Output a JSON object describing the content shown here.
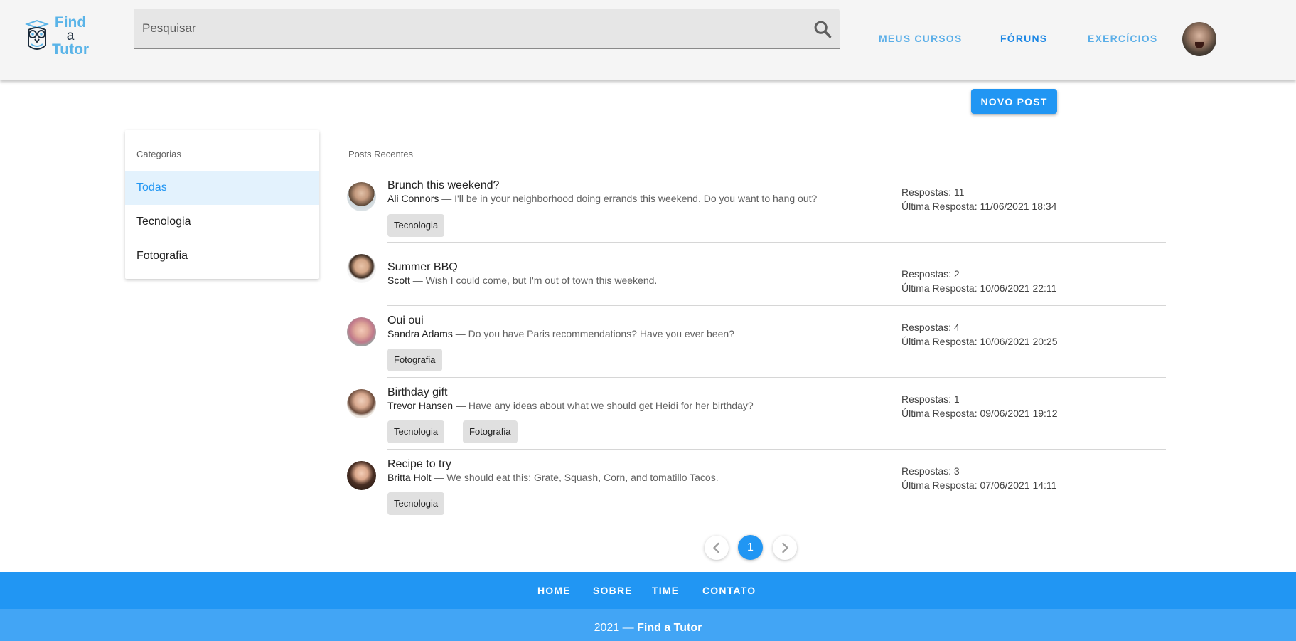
{
  "header": {
    "logo": {
      "line1": "Find",
      "line2": "a",
      "line3": "Tutor"
    },
    "search_placeholder": "Pesquisar",
    "nav": [
      "MEUS CURSOS",
      "FÓRUNS",
      "EXERCÍCIOS"
    ],
    "active_nav": "FÓRUNS"
  },
  "new_post_label": "NOVO POST",
  "categories": {
    "title": "Categorias",
    "items": [
      "Todas",
      "Tecnologia",
      "Fotografia"
    ],
    "selected": "Todas"
  },
  "posts": {
    "title": "Posts Recentes",
    "items": [
      {
        "title": "Brunch this weekend?",
        "author": "Ali Connors",
        "excerpt": " — I'll be in your neighborhood doing errands this weekend. Do you want to hang out?",
        "replies": "Respostas: 11",
        "last_reply": "Última Resposta: 11/06/2021 18:34",
        "tags": [
          "Tecnologia"
        ]
      },
      {
        "title": "Summer BBQ",
        "author": "Scott",
        "excerpt": " — Wish I could come, but I'm out of town this weekend.",
        "replies": "Respostas: 2",
        "last_reply": "Última Resposta: 10/06/2021 22:11",
        "tags": []
      },
      {
        "title": "Oui oui",
        "author": "Sandra Adams",
        "excerpt": " — Do you have Paris recommendations? Have you ever been?",
        "replies": "Respostas: 4",
        "last_reply": "Última Resposta: 10/06/2021 20:25",
        "tags": [
          "Fotografia"
        ]
      },
      {
        "title": "Birthday gift",
        "author": "Trevor Hansen",
        "excerpt": " — Have any ideas about what we should get Heidi for her birthday?",
        "replies": "Respostas: 1",
        "last_reply": "Última Resposta: 09/06/2021 19:12",
        "tags": [
          "Tecnologia",
          "Fotografia"
        ]
      },
      {
        "title": "Recipe to try",
        "author": "Britta Holt",
        "excerpt": " — We should eat this: Grate, Squash, Corn, and tomatillo Tacos.",
        "replies": "Respostas: 3",
        "last_reply": "Última Resposta: 07/06/2021 14:11",
        "tags": [
          "Tecnologia"
        ]
      }
    ]
  },
  "pagination": {
    "current_page": "1"
  },
  "footer": {
    "links": [
      "HOME",
      "SOBRE",
      "TIME",
      "CONTATO"
    ],
    "year_prefix": "2021 — ",
    "brand": "Find a Tutor"
  },
  "colors": {
    "primary": "#2196f3",
    "header_bg": "#f5f5f5",
    "nav_text": "#5aaee8",
    "chip_bg": "#e0e0e0",
    "footer_bottom": "#42a5f5"
  }
}
